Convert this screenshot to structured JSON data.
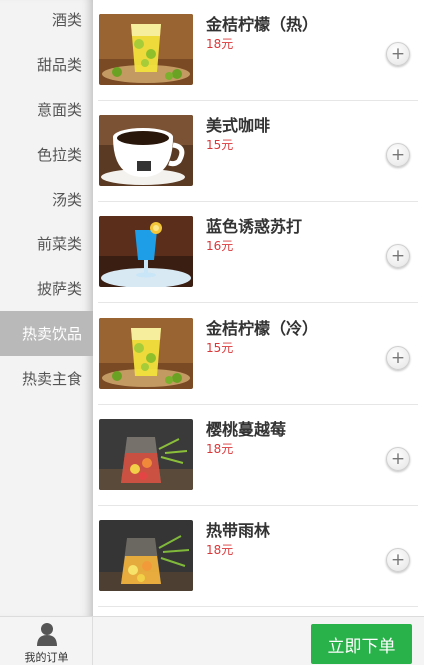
{
  "sidebar": {
    "items": [
      {
        "label": "酒类",
        "active": false
      },
      {
        "label": "甜品类",
        "active": false
      },
      {
        "label": "意面类",
        "active": false
      },
      {
        "label": "色拉类",
        "active": false
      },
      {
        "label": "汤类",
        "active": false
      },
      {
        "label": "前菜类",
        "active": false
      },
      {
        "label": "披萨类",
        "active": false
      },
      {
        "label": "热卖饮品",
        "active": true
      },
      {
        "label": "热卖主食",
        "active": false
      }
    ]
  },
  "products": [
    {
      "name": "金桔柠檬（热）",
      "price": "18元",
      "image": "kumquat-lemon-drink"
    },
    {
      "name": "美式咖啡",
      "price": "15元",
      "image": "coffee-cup"
    },
    {
      "name": "蓝色诱惑苏打",
      "price": "16元",
      "image": "blue-soda-glass"
    },
    {
      "name": "金桔柠檬（冷）",
      "price": "15元",
      "image": "kumquat-lemon-drink"
    },
    {
      "name": "樱桃蔓越莓",
      "price": "18元",
      "image": "fruit-tea-jug"
    },
    {
      "name": "热带雨林",
      "price": "18元",
      "image": "fruit-tea-jug"
    }
  ],
  "bottom_bar": {
    "my_orders_label": "我的订单",
    "my_orders_icon": "person-icon",
    "submit_label": "立即下单"
  },
  "colors": {
    "price": "#d9383a",
    "submit_button": "#29b14a",
    "active_category": "#b9b9b9"
  }
}
